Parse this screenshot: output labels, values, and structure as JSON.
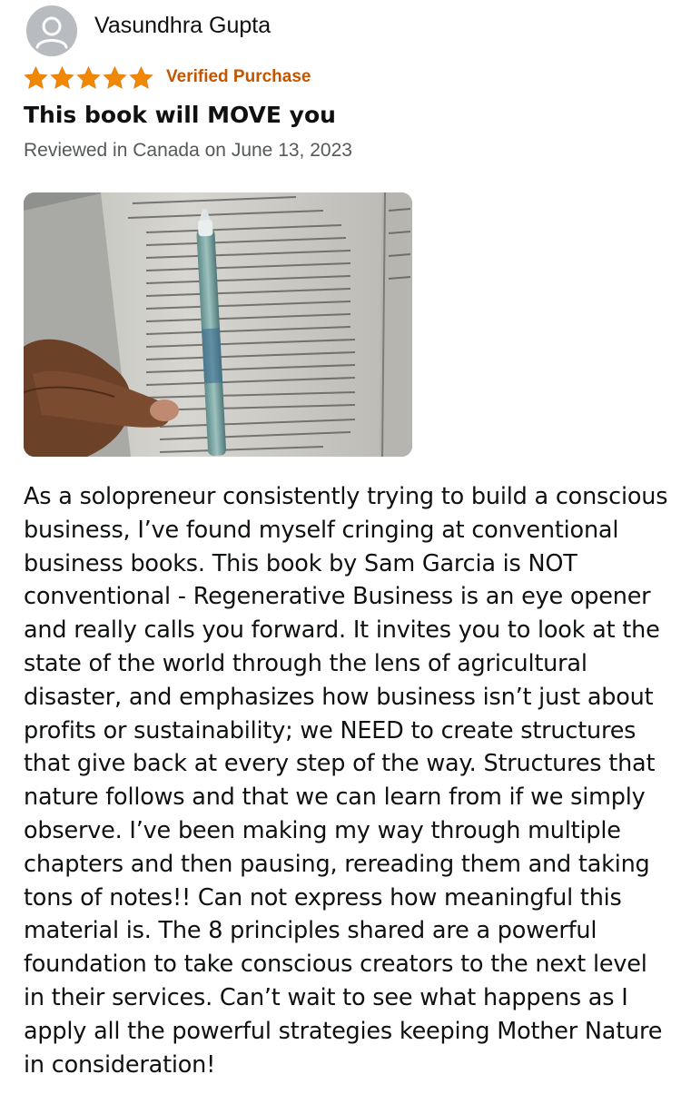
{
  "reviewer": {
    "name": "Vasundhra Gupta",
    "avatar_icon": "user-avatar-icon"
  },
  "rating": {
    "stars": 5,
    "max": 5,
    "star_color": "#f08804",
    "verified_label": "Verified Purchase",
    "verified_color": "#c45500"
  },
  "review": {
    "title": "This book will MOVE you",
    "date": "Reviewed in Canada on June 13, 2023",
    "photo_icon": "review-photo",
    "body_lines": [
      "As a solopreneur consistently trying to build a conscious",
      "business, I’ve found myself cringing at conventional",
      "business books. This book by Sam Garcia is NOT",
      "conventional - Regenerative Business is an eye opener",
      "and really calls you forward. It invites you to look at the",
      "state of the world through the lens of agricultural",
      "disaster, and emphasizes how business isn’t just about",
      "profits or sustainability; we NEED to create structures",
      "that give back at every step of the way. Structures that",
      "nature follows and that we can learn from if we simply",
      "observe. I’ve been making my way through multiple",
      "chapters and then pausing, rereading them and taking",
      "tons of notes!! Can not express how meaningful this",
      "material is. The 8 principles shared are a powerful",
      "foundation to take conscious creators to the next level",
      "in their services. Can’t wait to see what happens as I",
      "apply all the powerful strategies keeping Mother Nature",
      "in consideration!"
    ]
  }
}
